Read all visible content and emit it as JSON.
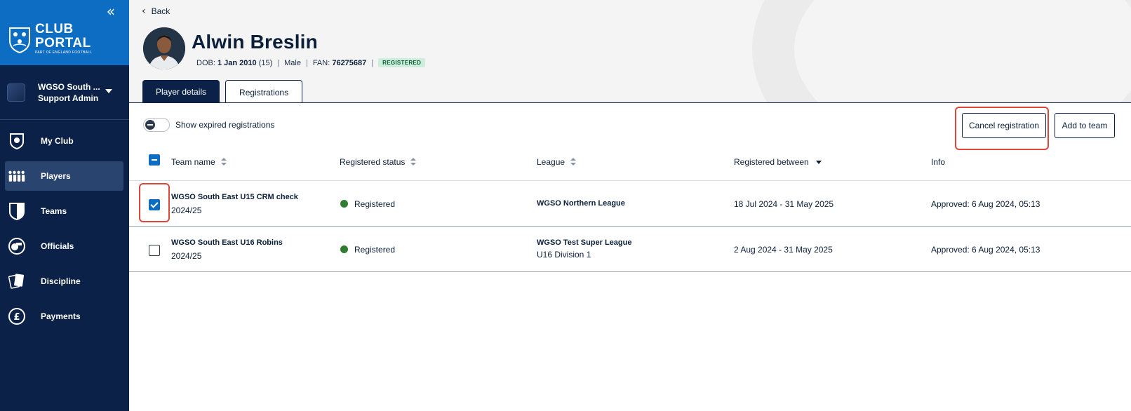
{
  "brand": {
    "line1": "CLUB",
    "line2": "PORTAL",
    "line3": "PART OF ENGLAND FOOTBALL",
    "collapse_glyph": "«"
  },
  "org": {
    "name": "WGSO South ...",
    "role": "Support Admin"
  },
  "nav": [
    {
      "label": "My Club",
      "icon": "club-crest-icon",
      "active": false
    },
    {
      "label": "Players",
      "icon": "players-icon",
      "active": true
    },
    {
      "label": "Teams",
      "icon": "shield-icon",
      "active": false
    },
    {
      "label": "Officials",
      "icon": "whistle-icon",
      "active": false
    },
    {
      "label": "Discipline",
      "icon": "cards-icon",
      "active": false
    },
    {
      "label": "Payments",
      "icon": "pound-icon",
      "active": false
    }
  ],
  "header": {
    "back_label": "Back",
    "player_name": "Alwin Breslin",
    "dob_label": "DOB:",
    "dob_value": "1 Jan 2010",
    "age": "(15)",
    "gender": "Male",
    "fan_label": "FAN:",
    "fan_value": "76275687",
    "status_badge": "REGISTERED"
  },
  "tabs": [
    {
      "label": "Player details",
      "active": false
    },
    {
      "label": "Registrations",
      "active": true
    }
  ],
  "toolbar": {
    "toggle_label": "Show expired registrations",
    "toggle_on": false,
    "cancel_label": "Cancel registration",
    "add_label": "Add to team"
  },
  "table": {
    "columns": [
      "Team name",
      "Registered status",
      "League",
      "Registered between",
      "Info"
    ],
    "rows": [
      {
        "checked": true,
        "team": "WGSO South East U15 CRM check",
        "season": "2024/25",
        "status": "Registered",
        "league": "WGSO Northern League",
        "division": "",
        "between": "18 Jul 2024 - 31 May 2025",
        "info": "Approved: 6 Aug 2024, 05:13"
      },
      {
        "checked": false,
        "team": "WGSO South East U16 Robins",
        "season": "2024/25",
        "status": "Registered",
        "league": "WGSO Test Super League",
        "division": "U16 Division 1",
        "between": "2 Aug 2024 - 31 May 2025",
        "info": "Approved: 6 Aug 2024, 05:13"
      }
    ]
  },
  "colors": {
    "sidebar": "#0b2147",
    "brand_blue": "#0c6dc2",
    "status_green": "#2e7d32",
    "highlight_red": "#e0473a"
  }
}
